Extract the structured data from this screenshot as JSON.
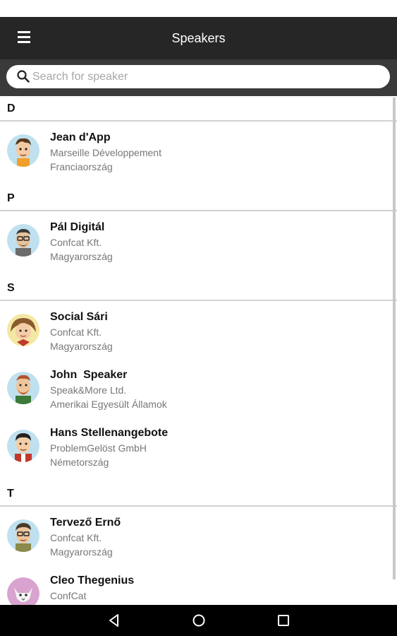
{
  "app": {
    "title": "Speakers"
  },
  "search": {
    "placeholder": "Search for speaker",
    "value": ""
  },
  "icons": {
    "menu": "menu-icon",
    "search": "search-icon",
    "back": "back-icon",
    "home": "home-icon",
    "recents": "recents-icon"
  },
  "colors": {
    "appbar": "#262626",
    "searchbar": "#3a3a3a",
    "navbar": "#000000",
    "divider": "#d2d2d2"
  },
  "sections": [
    {
      "letter": "D",
      "speakers": [
        {
          "name": "Jean d'App",
          "company": "Marseille Développement",
          "country": "Franciaország"
        }
      ]
    },
    {
      "letter": "P",
      "speakers": [
        {
          "name": "Pál Digitál",
          "company": "Confcat Kft.",
          "country": "Magyarország"
        }
      ]
    },
    {
      "letter": "S",
      "speakers": [
        {
          "name": "Social Sári",
          "company": "Confcat Kft.",
          "country": "Magyarország"
        },
        {
          "name": "John  Speaker",
          "company": "Speak&More Ltd.",
          "country": "Amerikai Egyesült Államok"
        },
        {
          "name": "Hans Stellenangebote",
          "company": "ProblemGelöst GmbH",
          "country": "Németország"
        }
      ]
    },
    {
      "letter": "T",
      "speakers": [
        {
          "name": "Tervező Ernő",
          "company": "Confcat Kft.",
          "country": "Magyarország"
        },
        {
          "name": "Cleo Thegenius",
          "company": "ConfCat",
          "country": ""
        }
      ]
    }
  ]
}
